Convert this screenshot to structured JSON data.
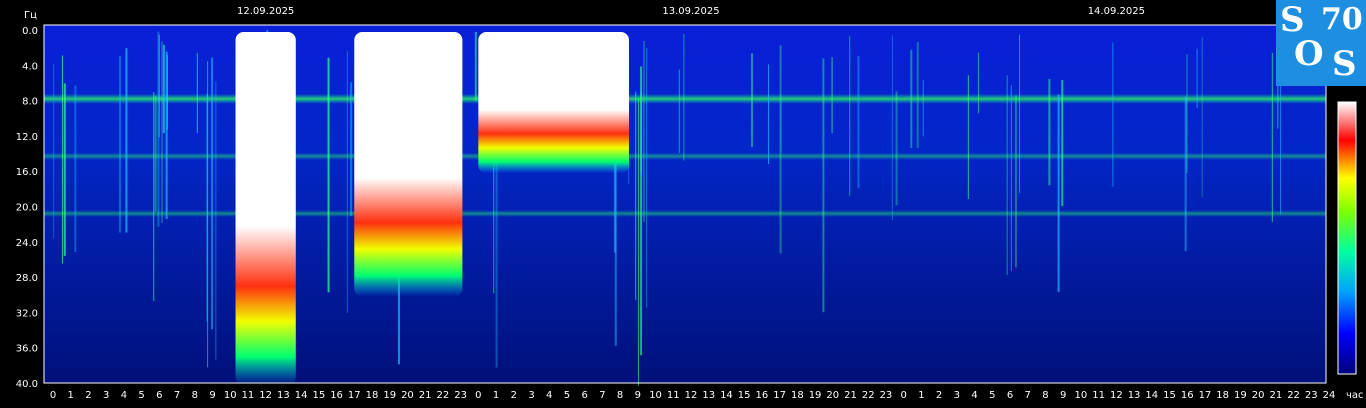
{
  "chart_data": {
    "type": "heatmap",
    "title": "",
    "ylabel": "Гц",
    "xlabel": "час",
    "ylim": [
      0,
      40
    ],
    "y_ticks": [
      "0.0",
      "4.0",
      "8.0",
      "12.0",
      "16.0",
      "20.0",
      "24.0",
      "28.0",
      "32.0",
      "36.0",
      "40.0"
    ],
    "dates": [
      "12.09.2025",
      "13.09.2025",
      "14.09.2025"
    ],
    "hour_ticks": [
      "0",
      "1",
      "2",
      "3",
      "4",
      "5",
      "6",
      "7",
      "8",
      "9",
      "10",
      "11",
      "12",
      "13",
      "14",
      "15",
      "16",
      "17",
      "18",
      "19",
      "20",
      "21",
      "22",
      "23",
      "0",
      "1",
      "2",
      "3",
      "4",
      "5",
      "6",
      "7",
      "8",
      "9",
      "10",
      "11",
      "12",
      "13",
      "14",
      "15",
      "16",
      "17",
      "18",
      "19",
      "20",
      "21",
      "22",
      "23",
      "0",
      "1",
      "2",
      "3",
      "4",
      "5",
      "6",
      "7",
      "8",
      "9",
      "10",
      "11",
      "12",
      "13",
      "14",
      "15",
      "16",
      "17",
      "18",
      "19",
      "20",
      "21",
      "22",
      "23",
      "24"
    ],
    "resonance_bands_hz": [
      7.8,
      14.3,
      20.8
    ],
    "high_intensity_bursts": [
      {
        "start_hour": 10.3,
        "end_hour": 13.7,
        "top_hz": 40
      },
      {
        "start_hour": 17.0,
        "end_hour": 23.1,
        "top_hz": 30
      },
      {
        "start_hour": 24.0,
        "end_hour": 32.5,
        "top_hz": 16
      }
    ],
    "colorscale": [
      "#00007a",
      "#0000ff",
      "#00a0ff",
      "#00ffa0",
      "#80ff00",
      "#ffff00",
      "#ff0000",
      "#ffffff"
    ]
  },
  "logo": {
    "letter_s": "S",
    "number": "70",
    "letter_o": "O",
    "letter_s2": "S"
  }
}
